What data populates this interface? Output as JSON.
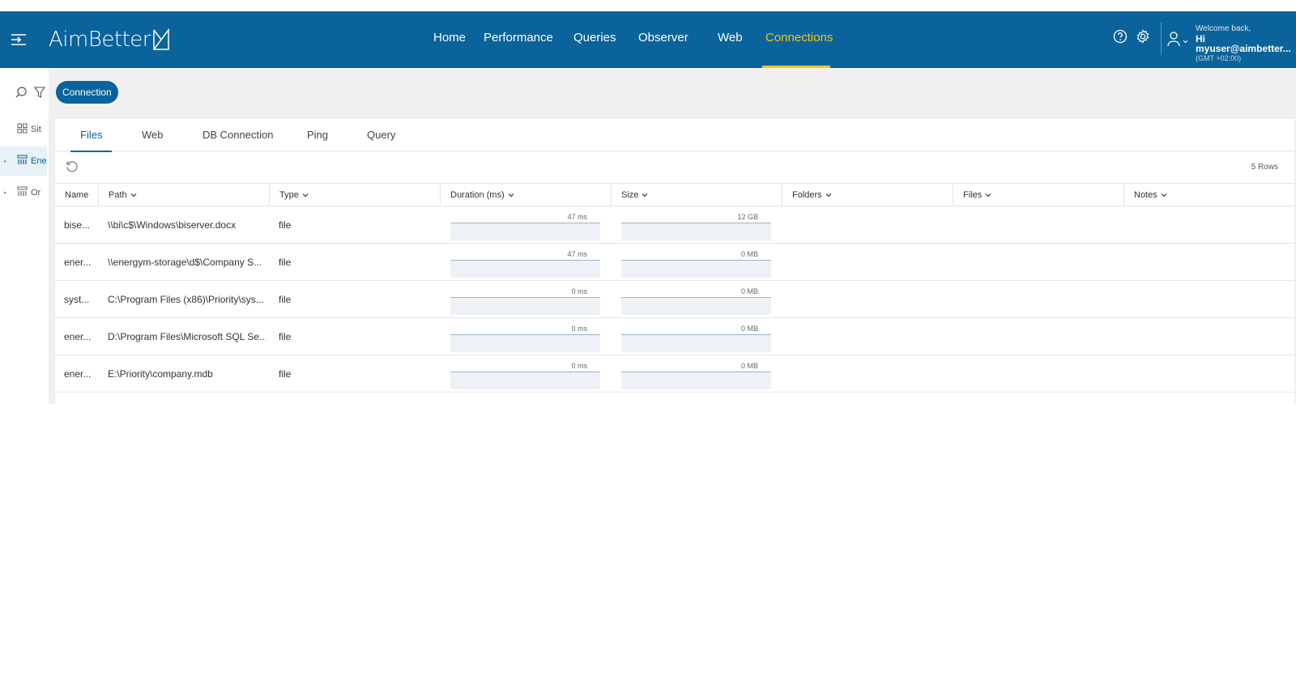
{
  "app": {
    "logo": "AimBetter"
  },
  "nav": {
    "items": [
      {
        "label": "Home"
      },
      {
        "label": "Performance"
      },
      {
        "label": "Queries"
      },
      {
        "label": "Observer"
      },
      {
        "label": "Web"
      },
      {
        "label": "Connections"
      }
    ],
    "active": "Connections"
  },
  "user": {
    "welcome": "Welcome back,",
    "greeting": "Hi myuser@aimbetter...",
    "timezone": "(GMT +02:00)"
  },
  "sidebar": {
    "items": [
      {
        "label": "Sit"
      },
      {
        "label": "Ene"
      },
      {
        "label": "Or"
      }
    ]
  },
  "filter_pill": {
    "label": "Connection"
  },
  "tabs": [
    {
      "label": "Files"
    },
    {
      "label": "Web"
    },
    {
      "label": "DB Connection"
    },
    {
      "label": "Ping"
    },
    {
      "label": "Query"
    }
  ],
  "toolbar": {
    "rows_count": "5 Rows"
  },
  "table": {
    "columns": [
      "Name",
      "Path",
      "Type",
      "Duration (ms)",
      "Size",
      "Folders",
      "Files",
      "Notes"
    ],
    "rows": [
      {
        "name": "bise...",
        "path": "\\\\bi\\c$\\Windows\\biserver.docx",
        "type": "file",
        "duration": "47 ms",
        "size": "12 GB"
      },
      {
        "name": "ener...",
        "path": "\\\\energym-storage\\d$\\Company S...",
        "type": "file",
        "duration": "47 ms",
        "size": "0 MB"
      },
      {
        "name": "syst...",
        "path": "C:\\Program Files (x86)\\Priority\\sys...",
        "type": "file",
        "duration": "0 ms",
        "size": "0 MB"
      },
      {
        "name": "ener...",
        "path": "D:\\Program Files\\Microsoft SQL Se...",
        "type": "file",
        "duration": "0 ms",
        "size": "0 MB"
      },
      {
        "name": "ener...",
        "path": "E:\\Priority\\company.mdb",
        "type": "file",
        "duration": "0 ms",
        "size": "0 MB"
      }
    ]
  },
  "colors": {
    "brand": "#0a639b",
    "accent": "#f5c518"
  }
}
